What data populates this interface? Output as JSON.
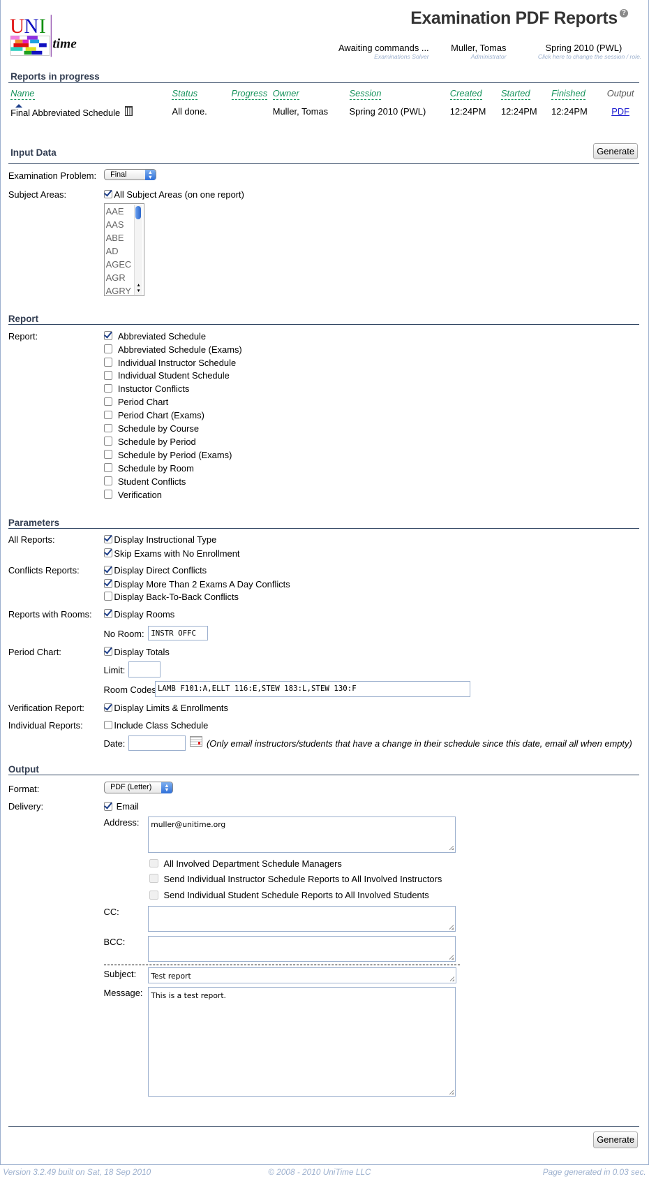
{
  "header": {
    "title": "Examination PDF Reports",
    "help_icon": "help-icon",
    "solver_status": "Awaiting commands ...",
    "solver_label": "Examinations Solver",
    "user": "Muller, Tomas",
    "role": "Administrator",
    "session": "Spring 2010 (PWL)",
    "session_hint": "Click here to change the session / role.",
    "logo_text": "UNI time"
  },
  "progress": {
    "title": "Reports in progress",
    "columns": [
      "Name",
      "Status",
      "Progress",
      "Owner",
      "Session",
      "Created",
      "Started",
      "Finished",
      "Output"
    ],
    "rows": [
      {
        "name": "Final Abbreviated Schedule",
        "status": "All done.",
        "progress": "",
        "owner": "Muller, Tomas",
        "session": "Spring 2010 (PWL)",
        "created": "12:24PM",
        "started": "12:24PM",
        "finished": "12:24PM",
        "output": "PDF"
      }
    ]
  },
  "input": {
    "title": "Input Data",
    "generate": "Generate",
    "problem_label": "Examination Problem:",
    "problem_value": "Final",
    "subject_label": "Subject Areas:",
    "all_subjects": "All Subject Areas (on one report)",
    "all_subjects_checked": true,
    "subjects": [
      "AAE",
      "AAS",
      "ABE",
      "AD",
      "AGEC",
      "AGR",
      "AGRY"
    ]
  },
  "report": {
    "title": "Report",
    "label": "Report:",
    "items": [
      {
        "label": "Abbreviated Schedule",
        "checked": true
      },
      {
        "label": "Abbreviated Schedule (Exams)",
        "checked": false
      },
      {
        "label": "Individual Instructor Schedule",
        "checked": false
      },
      {
        "label": "Individual Student Schedule",
        "checked": false
      },
      {
        "label": "Instuctor Conflicts",
        "checked": false
      },
      {
        "label": "Period Chart",
        "checked": false
      },
      {
        "label": "Period Chart (Exams)",
        "checked": false
      },
      {
        "label": "Schedule by Course",
        "checked": false
      },
      {
        "label": "Schedule by Period",
        "checked": false
      },
      {
        "label": "Schedule by Period (Exams)",
        "checked": false
      },
      {
        "label": "Schedule by Room",
        "checked": false
      },
      {
        "label": "Student Conflicts",
        "checked": false
      },
      {
        "label": "Verification",
        "checked": false
      }
    ]
  },
  "params": {
    "title": "Parameters",
    "all_label": "All Reports:",
    "instr_type": "Display Instructional Type",
    "skip_exams": "Skip Exams with No Enrollment",
    "conf_label": "Conflicts Reports:",
    "direct": "Display Direct Conflicts",
    "more2": "Display More Than 2 Exams A Day Conflicts",
    "b2b": "Display Back-To-Back Conflicts",
    "rooms_label": "Reports with Rooms:",
    "disp_rooms": "Display Rooms",
    "noroom_label": "No Room:",
    "noroom_value": "INSTR OFFC",
    "period_label": "Period Chart:",
    "totals": "Display Totals",
    "limit_label": "Limit:",
    "limit_value": "",
    "codes_label": "Room Codes:",
    "codes_value": "LAMB F101:A,ELLT 116:E,STEW 183:L,STEW 130:F",
    "verif_label": "Verification Report:",
    "limits": "Display Limits & Enrollments",
    "indiv_label": "Individual Reports:",
    "class_sched": "Include Class Schedule",
    "date_label": "Date:",
    "date_value": "",
    "date_note": "(Only email instructors/students that have a change in their schedule since this date, email all when empty)"
  },
  "output": {
    "title": "Output",
    "format_label": "Format:",
    "format_value": "PDF (Letter)",
    "delivery_label": "Delivery:",
    "email": "Email",
    "address_label": "Address:",
    "address_value": "muller@unitime.org",
    "managers": "All Involved Department Schedule Managers",
    "to_instructors": "Send Individual Instructor Schedule Reports to All Involved Instructors",
    "to_students": "Send Individual Student Schedule Reports to All Involved Students",
    "cc_label": "CC:",
    "cc_value": "",
    "bcc_label": "BCC:",
    "bcc_value": "",
    "subject_label": "Subject:",
    "subject_value": "Test report",
    "message_label": "Message:",
    "message_value": "This is a test report.",
    "generate": "Generate"
  },
  "footer": {
    "version": "Version 3.2.49 built on Sat, 18 Sep 2010",
    "copyright": "© 2008 - 2010 UniTime LLC",
    "generated": "Page generated in 0.03 sec."
  },
  "colors": {
    "header_line": "#2f4461",
    "sort_header": "#17935c",
    "footer_text": "#9cb0ce",
    "link": "#1a1ad0"
  }
}
